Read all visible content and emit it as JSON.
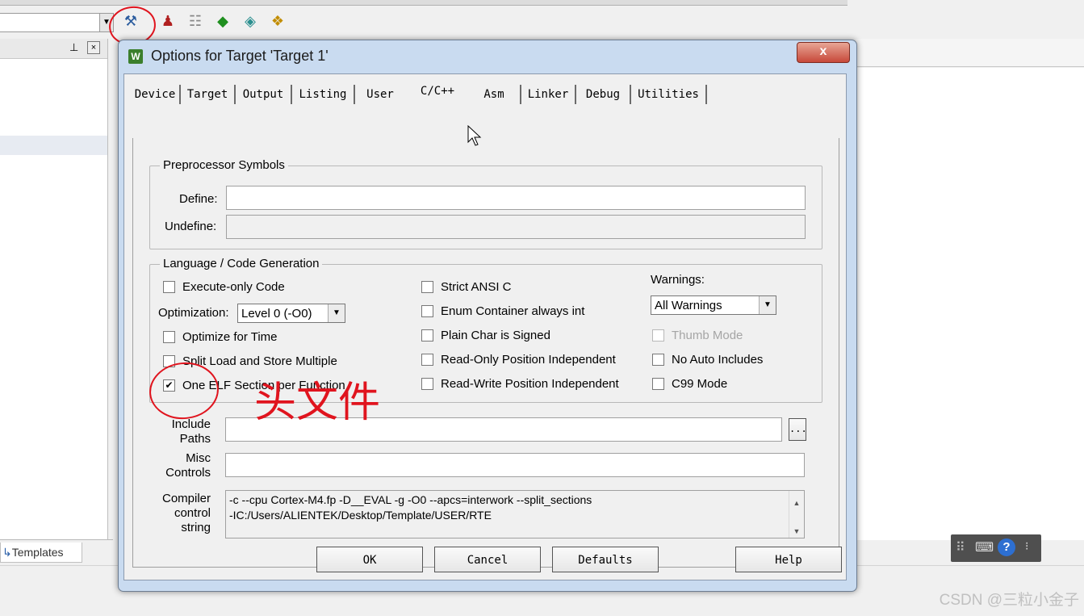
{
  "dialog": {
    "title": "Options for Target 'Target 1'",
    "close_label": "x",
    "tabs": [
      {
        "label": "Device"
      },
      {
        "label": "Target"
      },
      {
        "label": "Output"
      },
      {
        "label": "Listing"
      },
      {
        "label": "User"
      },
      {
        "label": "C/C++"
      },
      {
        "label": "Asm"
      },
      {
        "label": "Linker"
      },
      {
        "label": "Debug"
      },
      {
        "label": "Utilities"
      }
    ],
    "active_tab": "C/C++",
    "preprocessor": {
      "group_label": "Preprocessor Symbols",
      "define_label": "Define:",
      "define_value": "",
      "undefine_label": "Undefine:",
      "undefine_value": ""
    },
    "language": {
      "group_label": "Language / Code Generation",
      "execute_only": {
        "label": "Execute-only Code",
        "checked": false
      },
      "optimization_label": "Optimization:",
      "optimization_value": "Level 0 (-O0)",
      "optimize_time": {
        "label": "Optimize for Time",
        "checked": false
      },
      "split_load": {
        "label": "Split Load and Store Multiple",
        "checked": false
      },
      "one_elf": {
        "label": "One ELF Section per Function",
        "checked": true
      },
      "strict_ansi": {
        "label": "Strict ANSI C",
        "checked": false
      },
      "enum_container": {
        "label": "Enum Container always int",
        "checked": false
      },
      "plain_char": {
        "label": "Plain Char is Signed",
        "checked": false
      },
      "ro_pi": {
        "label": "Read-Only Position Independent",
        "checked": false
      },
      "rw_pi": {
        "label": "Read-Write Position Independent",
        "checked": false
      },
      "warnings_label": "Warnings:",
      "warnings_value": "All Warnings",
      "thumb_mode": {
        "label": "Thumb Mode",
        "checked": false,
        "disabled": true
      },
      "no_auto_includes": {
        "label": "No Auto Includes",
        "checked": false
      },
      "c99_mode": {
        "label": "C99 Mode",
        "checked": false
      }
    },
    "include_paths": {
      "label_line1": "Include",
      "label_line2": "Paths",
      "value": "",
      "browse_label": "..."
    },
    "misc_controls": {
      "label_line1": "Misc",
      "label_line2": "Controls",
      "value": ""
    },
    "compiler_string": {
      "label_line1": "Compiler",
      "label_line2": "control",
      "label_line3": "string",
      "line1": "-c --cpu Cortex-M4.fp -D__EVAL -g -O0 --apcs=interwork --split_sections",
      "line2": "-IC:/Users/ALIENTEK/Desktop/Template/USER/RTE"
    },
    "buttons": {
      "ok": "OK",
      "cancel": "Cancel",
      "defaults": "Defaults",
      "help": "Help"
    }
  },
  "annotation": {
    "handwritten_text": "头文件",
    "color": "#e0141e"
  },
  "background": {
    "left_tab_label": "Templates",
    "watermark": "CSDN @三粒小金子"
  },
  "colors": {
    "dialog_frame": "#c9dbf0",
    "client_bg": "#f0f0f0",
    "close_button": "#c7493a"
  }
}
